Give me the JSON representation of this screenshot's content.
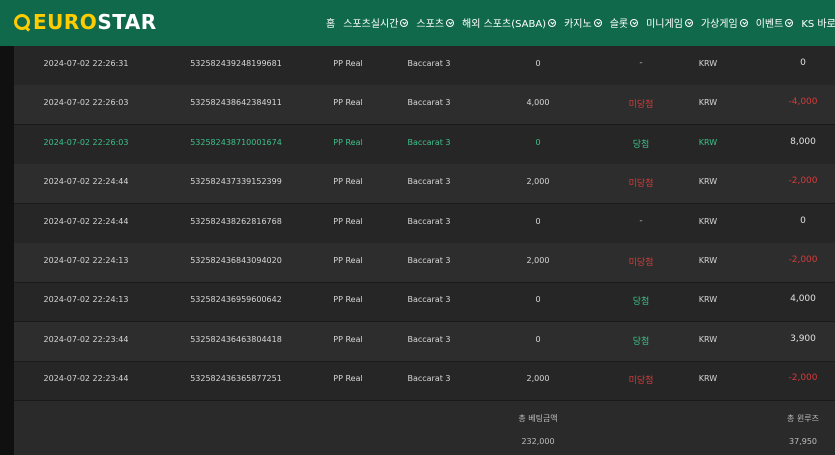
{
  "brand": {
    "light": "EURO",
    "bold": "STAR"
  },
  "nav": [
    {
      "label": "홈",
      "chevron": false
    },
    {
      "label": "스포츠실시간",
      "chevron": true
    },
    {
      "label": "스포츠",
      "chevron": true
    },
    {
      "label": "해외 스포츠(SABA)",
      "chevron": true
    },
    {
      "label": "카지노",
      "chevron": true
    },
    {
      "label": "슬롯",
      "chevron": true
    },
    {
      "label": "미니게임",
      "chevron": true
    },
    {
      "label": "가상게임",
      "chevron": true
    },
    {
      "label": "이벤트",
      "chevron": true
    },
    {
      "label": "KS 바로가",
      "chevron": false
    }
  ],
  "rows": [
    {
      "date": "2024-07-02 22:26:31",
      "id": "532582439248199681",
      "provider": "PP Real",
      "game": "Baccarat 3",
      "bet": "0",
      "result": "-",
      "result_type": "none",
      "currency": "KRW",
      "win": "0",
      "win_type": "pos",
      "highlight": false
    },
    {
      "date": "2024-07-02 22:26:03",
      "id": "532582438642384911",
      "provider": "PP Real",
      "game": "Baccarat 3",
      "bet": "4,000",
      "result": "미당첨",
      "result_type": "lose",
      "currency": "KRW",
      "win": "-4,000",
      "win_type": "neg",
      "highlight": false
    },
    {
      "date": "2024-07-02 22:26:03",
      "id": "532582438710001674",
      "provider": "PP Real",
      "game": "Baccarat 3",
      "bet": "0",
      "result": "당첨",
      "result_type": "win",
      "currency": "KRW",
      "win": "8,000",
      "win_type": "pos",
      "highlight": true
    },
    {
      "date": "2024-07-02 22:24:44",
      "id": "532582437339152399",
      "provider": "PP Real",
      "game": "Baccarat 3",
      "bet": "2,000",
      "result": "미당첨",
      "result_type": "lose",
      "currency": "KRW",
      "win": "-2,000",
      "win_type": "neg",
      "highlight": false
    },
    {
      "date": "2024-07-02 22:24:44",
      "id": "532582438262816768",
      "provider": "PP Real",
      "game": "Baccarat 3",
      "bet": "0",
      "result": "-",
      "result_type": "none",
      "currency": "KRW",
      "win": "0",
      "win_type": "pos",
      "highlight": false
    },
    {
      "date": "2024-07-02 22:24:13",
      "id": "532582436843094020",
      "provider": "PP Real",
      "game": "Baccarat 3",
      "bet": "2,000",
      "result": "미당첨",
      "result_type": "lose",
      "currency": "KRW",
      "win": "-2,000",
      "win_type": "neg",
      "highlight": false
    },
    {
      "date": "2024-07-02 22:24:13",
      "id": "532582436959600642",
      "provider": "PP Real",
      "game": "Baccarat 3",
      "bet": "0",
      "result": "당첨",
      "result_type": "win",
      "currency": "KRW",
      "win": "4,000",
      "win_type": "pos",
      "highlight": false
    },
    {
      "date": "2024-07-02 22:23:44",
      "id": "532582436463804418",
      "provider": "PP Real",
      "game": "Baccarat 3",
      "bet": "0",
      "result": "당첨",
      "result_type": "win",
      "currency": "KRW",
      "win": "3,900",
      "win_type": "pos",
      "highlight": false
    },
    {
      "date": "2024-07-02 22:23:44",
      "id": "532582436365877251",
      "provider": "PP Real",
      "game": "Baccarat 3",
      "bet": "2,000",
      "result": "미당첨",
      "result_type": "lose",
      "currency": "KRW",
      "win": "-2,000",
      "win_type": "neg",
      "highlight": false
    }
  ],
  "summary": {
    "bet_label": "총 베팅금액",
    "bet_total": "232,000",
    "win_label": "총 윈루즈",
    "win_total": "37,950"
  },
  "colors": {
    "header": "#11694c",
    "brand": "#ffcc00",
    "win": "#3dc08a",
    "lose": "#d53b3b"
  }
}
